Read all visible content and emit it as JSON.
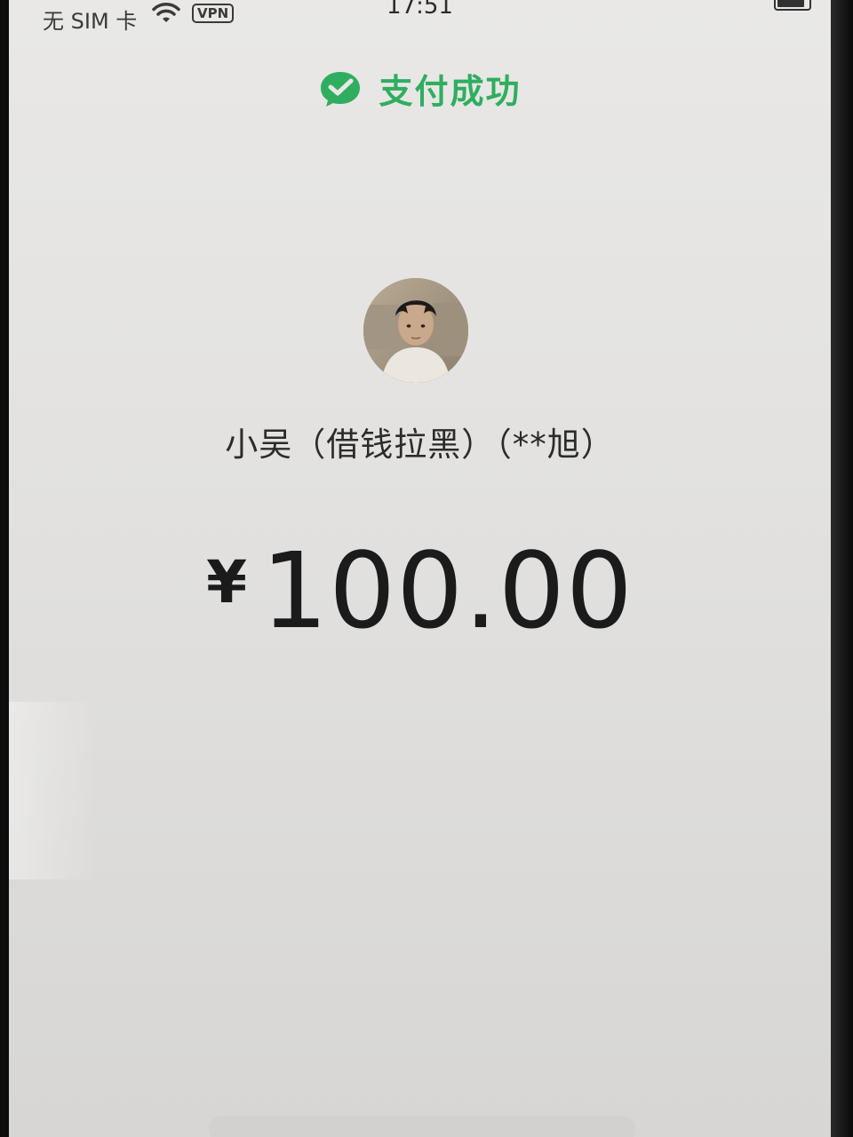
{
  "status_bar": {
    "carrier": "无 SIM 卡",
    "vpn_label": "VPN",
    "time": "17:51",
    "wifi_icon": "wifi-icon",
    "battery_icon": "battery-icon"
  },
  "header": {
    "title": "支付成功",
    "icon": "wechat-pay-check-icon",
    "accent_color": "#2fae5f"
  },
  "payee": {
    "avatar_icon": "avatar",
    "name": "小吴（借钱拉黑）（**旭）"
  },
  "payment": {
    "currency_symbol": "¥",
    "amount": "100.00"
  }
}
